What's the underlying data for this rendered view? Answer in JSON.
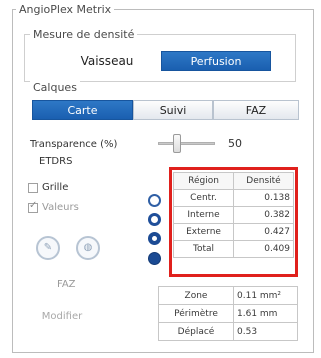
{
  "panel_title": "AngioPlex Metrix",
  "density_group_title": "Mesure de densité",
  "density_tabs": [
    {
      "label": "Vaisseau",
      "active": false
    },
    {
      "label": "Perfusion",
      "active": true
    }
  ],
  "layers_title": "Calques",
  "layer_tabs": [
    {
      "label": "Carte",
      "active": true
    },
    {
      "label": "Suivi",
      "active": false
    },
    {
      "label": "FAZ",
      "active": false
    }
  ],
  "transparency": {
    "label": "Transparence (%)",
    "value": "50",
    "fraction": 0.3
  },
  "etdrs_label": "ETDRS",
  "options": {
    "grid_label": "Grille",
    "values_label": "Valeurs"
  },
  "faz_label": "FAZ",
  "modify_label": "Modifier",
  "region_table": {
    "headers": [
      "Région",
      "Densité"
    ],
    "rows": [
      {
        "region": "Centr.",
        "value": "0.138"
      },
      {
        "region": "Interne",
        "value": "0.382"
      },
      {
        "region": "Externe",
        "value": "0.427"
      },
      {
        "region": "Total",
        "value": "0.409"
      }
    ]
  },
  "stats": [
    {
      "label": "Zone",
      "value": "0.11 mm²"
    },
    {
      "label": "Périmètre",
      "value": "1.61 mm"
    },
    {
      "label": "Déplacé",
      "value": "0.53"
    }
  ],
  "colors": {
    "accent": "#1f66b7",
    "highlight": "#e0201c"
  }
}
